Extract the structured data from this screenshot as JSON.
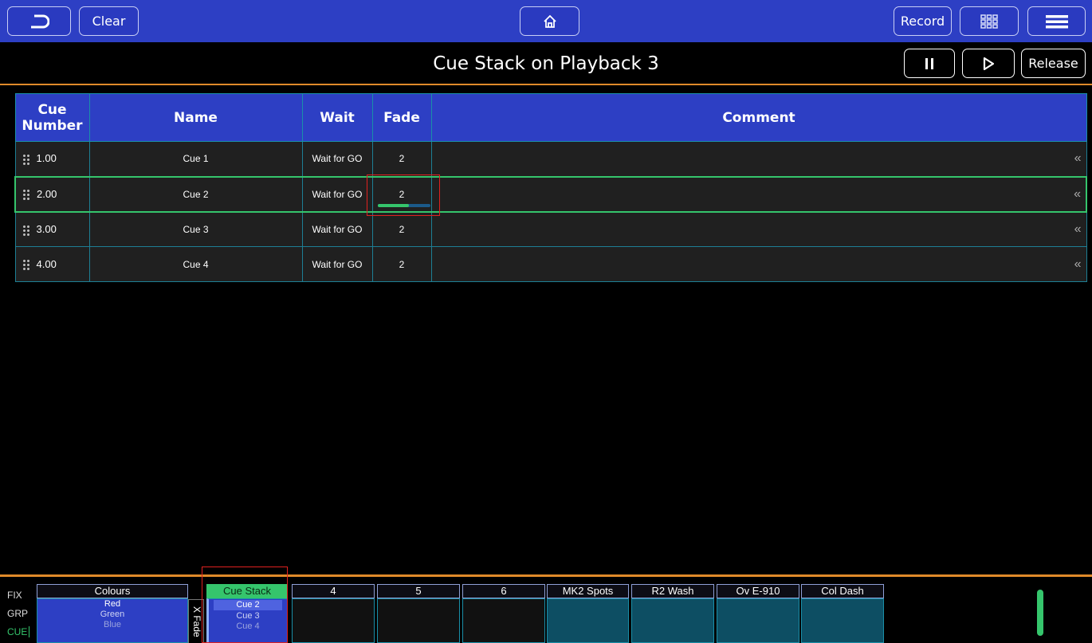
{
  "topbar": {
    "clear_label": "Clear",
    "record_label": "Record"
  },
  "title": "Cue Stack on Playback 3",
  "playback_controls": {
    "release_label": "Release"
  },
  "table": {
    "headers": [
      "Cue Number",
      "Name",
      "Wait",
      "Fade",
      "Comment"
    ],
    "header_cue_line1": "Cue",
    "header_cue_line2": "Number",
    "rows": [
      {
        "number": "1.00",
        "name": "Cue 1",
        "wait": "Wait for GO",
        "fade": "2",
        "comment": ""
      },
      {
        "number": "2.00",
        "name": "Cue 2",
        "wait": "Wait for GO",
        "fade": "2",
        "comment": "",
        "fade_progress": 0.6
      },
      {
        "number": "3.00",
        "name": "Cue 3",
        "wait": "Wait for GO",
        "fade": "2",
        "comment": ""
      },
      {
        "number": "4.00",
        "name": "Cue 4",
        "wait": "Wait for GO",
        "fade": "2",
        "comment": ""
      }
    ]
  },
  "side_labels": [
    "FIX",
    "GRP",
    "CUE"
  ],
  "playbacks": [
    {
      "label": "Colours",
      "items": [
        "Red",
        "Green",
        "Blue"
      ]
    },
    {
      "label": "Cue Stack",
      "items": [
        "Cue 2",
        "Cue 3",
        "Cue 4"
      ]
    },
    {
      "label": "4"
    },
    {
      "label": "5"
    },
    {
      "label": "6"
    },
    {
      "label": "MK2 Spots"
    },
    {
      "label": "R2 Wash"
    },
    {
      "label": "Ov E-910"
    },
    {
      "label": "Col Dash"
    }
  ],
  "xfade_label": "X Fade",
  "colors": {
    "accent_blue": "#2d3fc4",
    "active_green": "#35c56c",
    "divider_orange": "#e08a2a",
    "teal": "#0d4e63",
    "highlight_red": "#e0211f"
  }
}
